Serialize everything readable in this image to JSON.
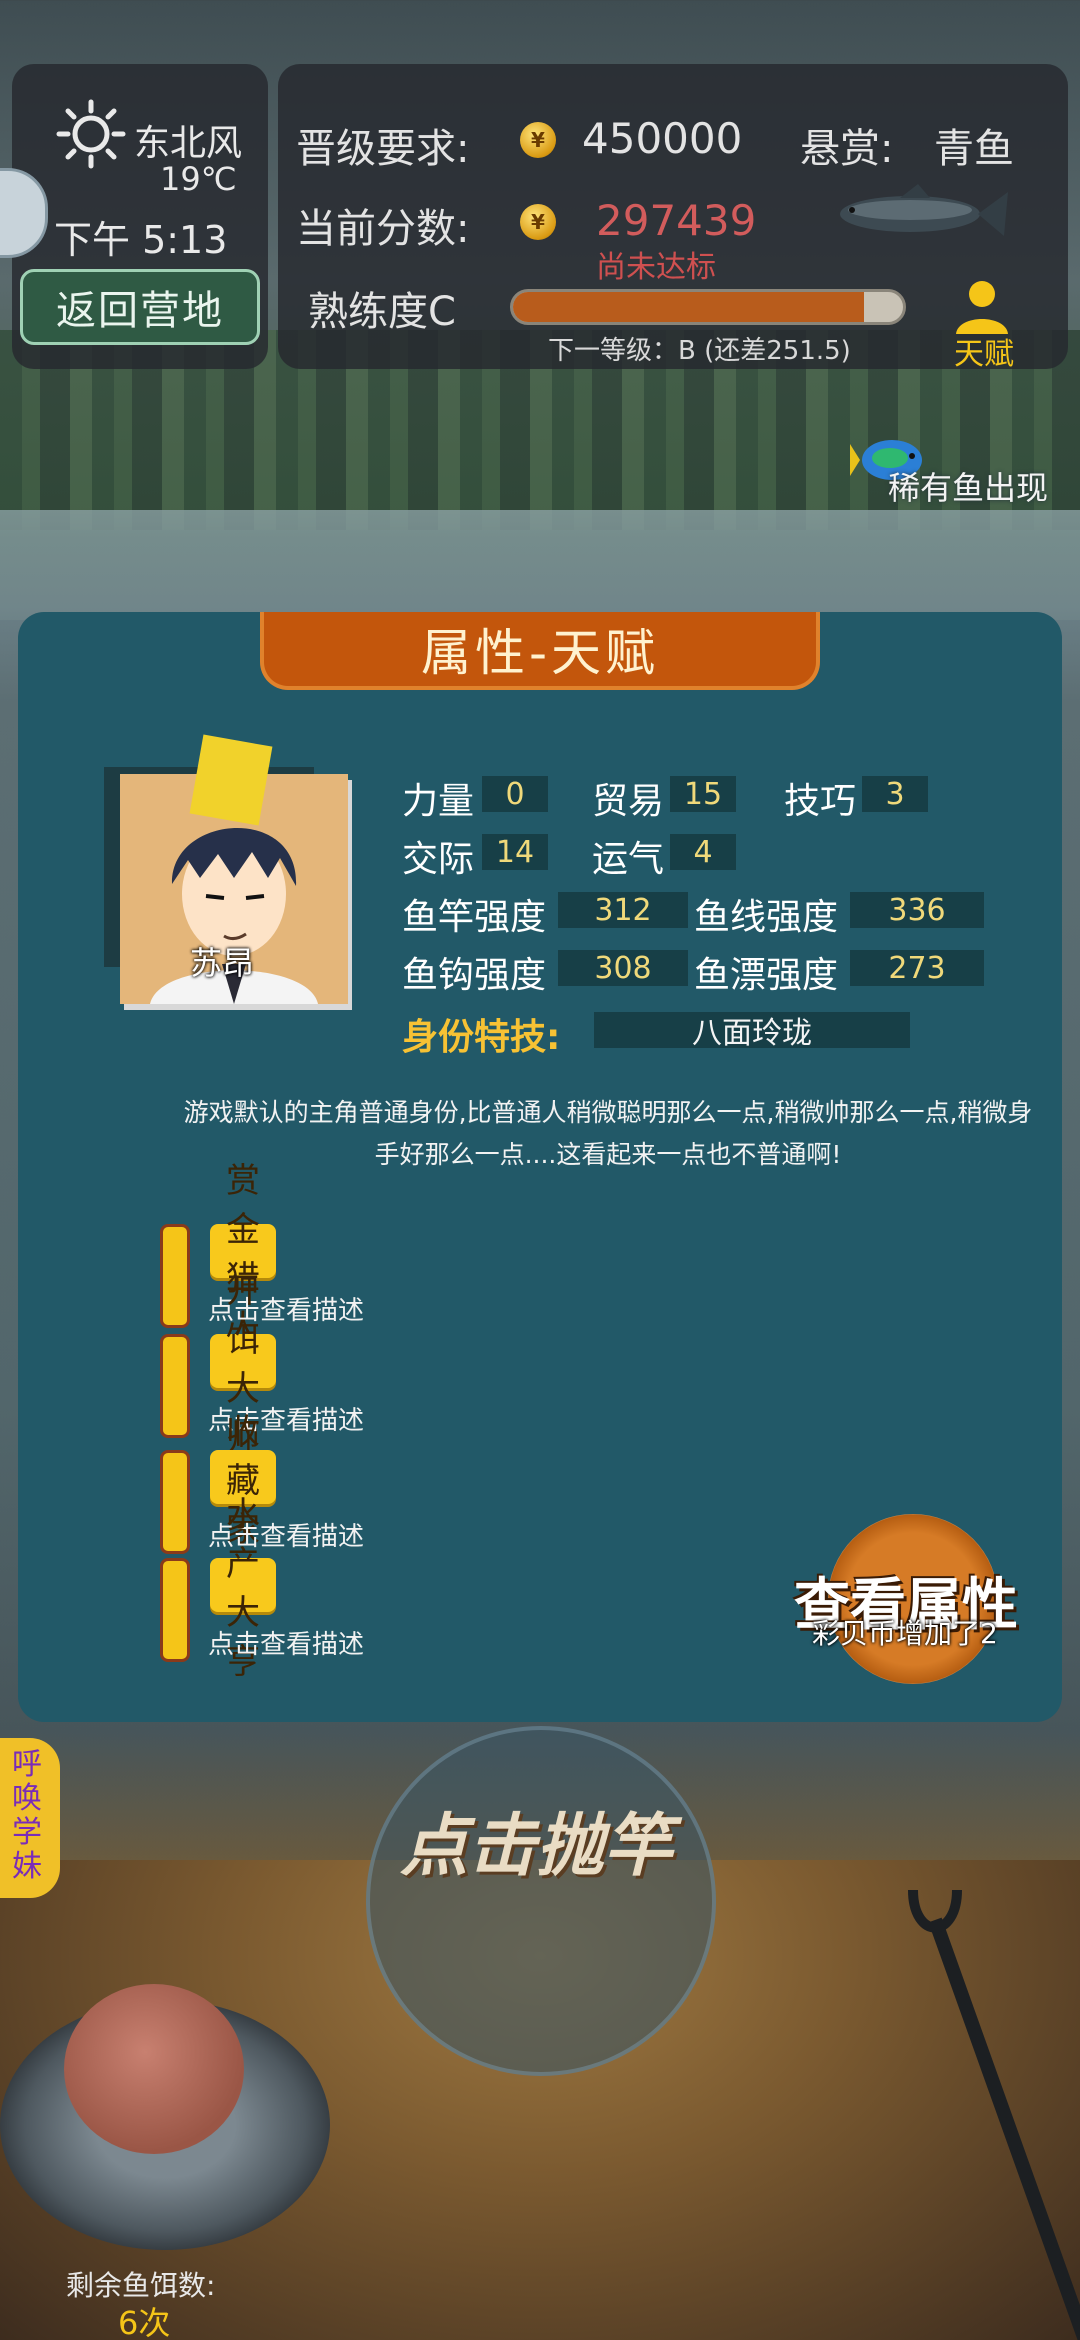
{
  "weather": {
    "wind": "东北风",
    "temperature": "19℃",
    "time": "下午 5:13",
    "back_button": "返回营地",
    "icon": "sun-icon"
  },
  "goal": {
    "promotion_label": "晋级要求:",
    "promotion_value": "450000",
    "current_label": "当前分数:",
    "current_value": "297439",
    "not_met": "尚未达标",
    "bounty_label": "悬赏:",
    "bounty_fish": "青鱼",
    "proficiency_label": "熟练度C",
    "proficiency_progress": 0.9,
    "next_level": "下一等级：B (还差251.5)",
    "talent_button": "天赋",
    "coin_glyph": "¥"
  },
  "rare_fish": "稀有鱼出现",
  "modal": {
    "title": "属性-天赋",
    "character_name": "苏昂",
    "stats": [
      {
        "label": "力量",
        "value": "0"
      },
      {
        "label": "贸易",
        "value": "15"
      },
      {
        "label": "技巧",
        "value": "3"
      },
      {
        "label": "交际",
        "value": "14"
      },
      {
        "label": "运气",
        "value": "4"
      }
    ],
    "strengths": [
      {
        "label": "鱼竿强度",
        "value": "312"
      },
      {
        "label": "鱼线强度",
        "value": "336"
      },
      {
        "label": "鱼钩强度",
        "value": "308"
      },
      {
        "label": "鱼漂强度",
        "value": "273"
      }
    ],
    "identity_skill_label": "身份特技:",
    "identity_skill": "八面玲珑",
    "description": "游戏默认的主角普通身份,比普通人稍微聪明那么一点,稍微帅那么一点,稍微身手好那么一点....这看起来一点也不普通啊!",
    "talents": [
      {
        "name": "赏金猎人",
        "hint": "点击查看描述"
      },
      {
        "name": "开饵大师",
        "hint": "点击查看描述"
      },
      {
        "name": "收藏家",
        "hint": "点击查看描述"
      },
      {
        "name": "水产大亨",
        "hint": "点击查看描述"
      }
    ],
    "view_attributes": "查看属性",
    "toast": "彩贝币增加了2"
  },
  "bottom": {
    "cast": "点击抛竿",
    "summon": "呼唤学妹",
    "bait_label": "剩余鱼饵数:",
    "bait_count": "6次"
  },
  "colors": {
    "modal_bg": "#225968",
    "title_bg": "#c3560c",
    "accent_yellow": "#f5c518",
    "warn_red": "#d25c5c"
  }
}
